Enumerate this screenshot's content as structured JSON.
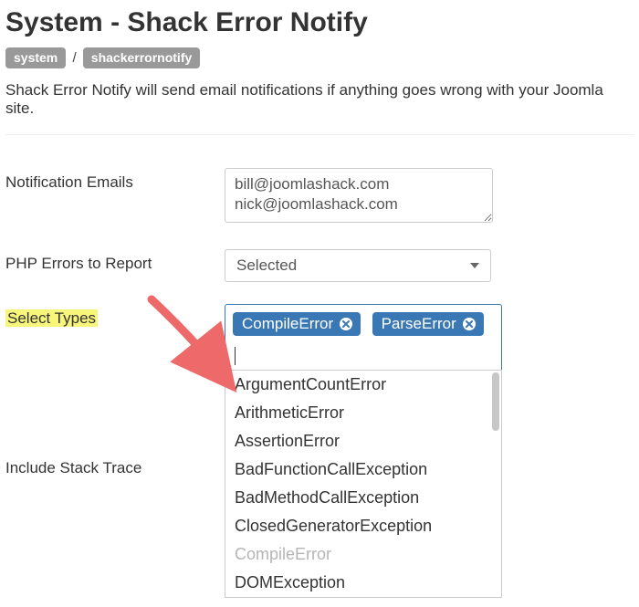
{
  "title": "System - Shack Error Notify",
  "breadcrumb": {
    "a": "system",
    "b": "shackerrornotify",
    "sep": "/"
  },
  "description": "Shack Error Notify will send email notifications if anything goes wrong with your Joomla site.",
  "labels": {
    "emails": "Notification Emails",
    "phpErrors": "PHP Errors to Report",
    "selectTypes": "Select Types",
    "stackTrace": "Include Stack Trace"
  },
  "emailsValue": "bill@joomlashack.com\nnick@joomlashack.com",
  "phpErrorsSelected": "Selected",
  "selectedTypes": {
    "t0": "CompileError",
    "t1": "ParseError"
  },
  "typeOptions": {
    "o0": "ArgumentCountError",
    "o1": "ArithmeticError",
    "o2": "AssertionError",
    "o3": "BadFunctionCallException",
    "o4": "BadMethodCallException",
    "o5": "ClosedGeneratorException",
    "o6": "CompileError",
    "o7": "DOMException"
  }
}
